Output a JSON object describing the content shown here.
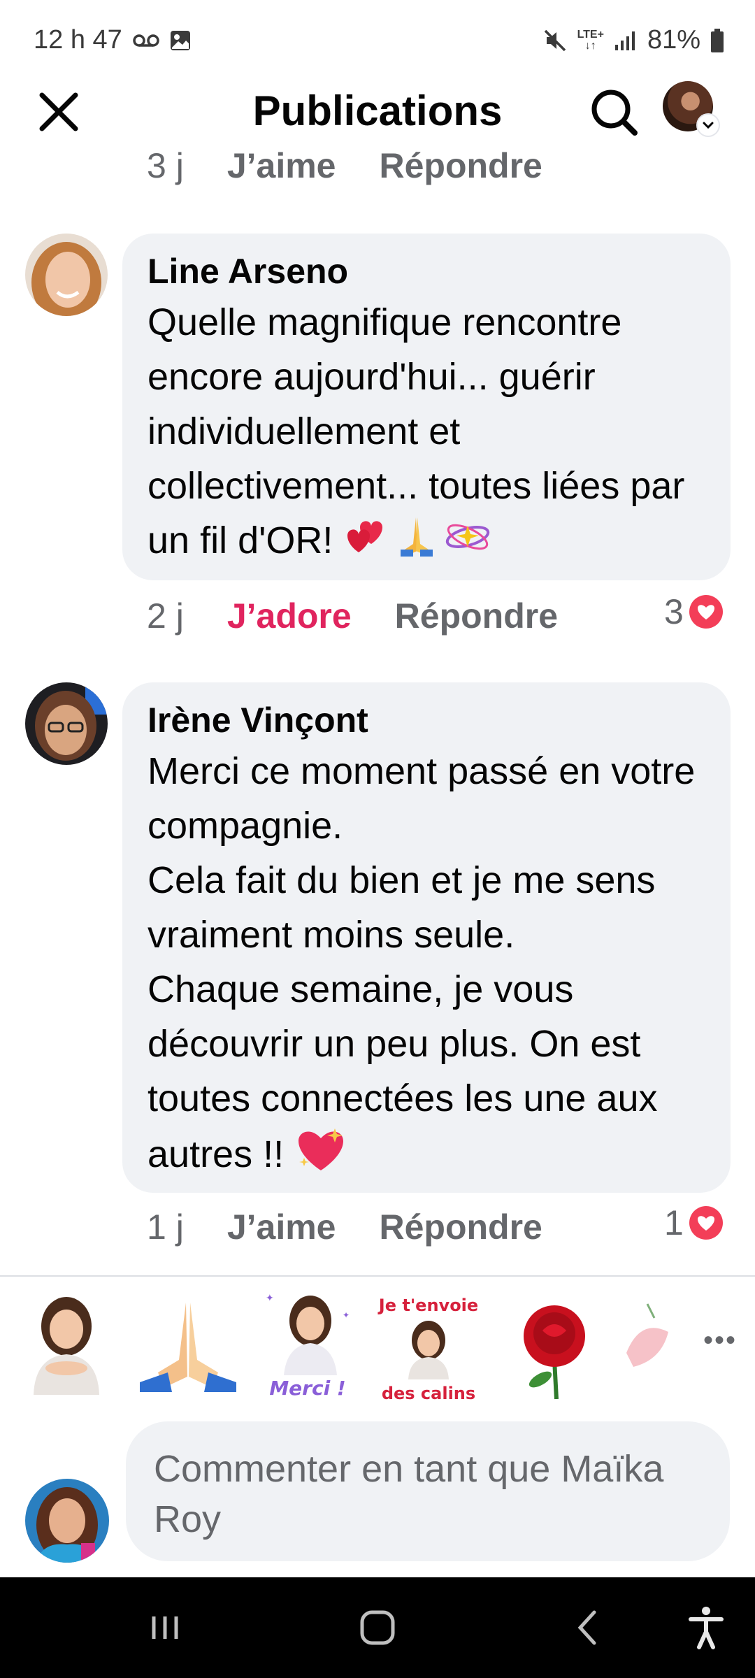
{
  "status_bar": {
    "time": "12 h 47",
    "network": "LTE+",
    "battery": "81%"
  },
  "header": {
    "title": "Publications"
  },
  "previous_comment_meta": {
    "time": "3 j",
    "like": "J’aime",
    "reply": "Répondre"
  },
  "comments": [
    {
      "author": "Line Arseno",
      "text": "Quelle magnifique rencontre encore aujourd'hui... guérir individuellement et collectivement... toutes liées par un fil d'OR!",
      "time": "2 j",
      "reaction_label": "J’adore",
      "reply": "Répondre",
      "reaction_count": "3"
    },
    {
      "author": "Irène Vinçont",
      "text_lines": [
        "Merci ce moment passé en votre compagnie.",
        "Cela fait du bien et je me sens vraiment moins seule.",
        "Chaque semaine, je vous découvrir un peu plus. On est toutes connectées les une aux autres !!"
      ],
      "time": "1 j",
      "reaction_label": "J’aime",
      "reply": "Répondre",
      "reaction_count": "1"
    }
  ],
  "stickers": {
    "merci": "Merci !",
    "calins_top": "Je t'envoie",
    "calins_bottom": "des calins"
  },
  "composer": {
    "placeholder": "Commenter en tant que Maïka Roy"
  },
  "icons": [
    "close-icon",
    "search-icon",
    "heart-icon",
    "more-icon",
    "recent-apps-icon",
    "home-icon",
    "back-icon",
    "accessibility-icon"
  ],
  "colors": {
    "love": "#e0245e",
    "bubble": "#f0f2f5",
    "meta": "#65676b"
  }
}
